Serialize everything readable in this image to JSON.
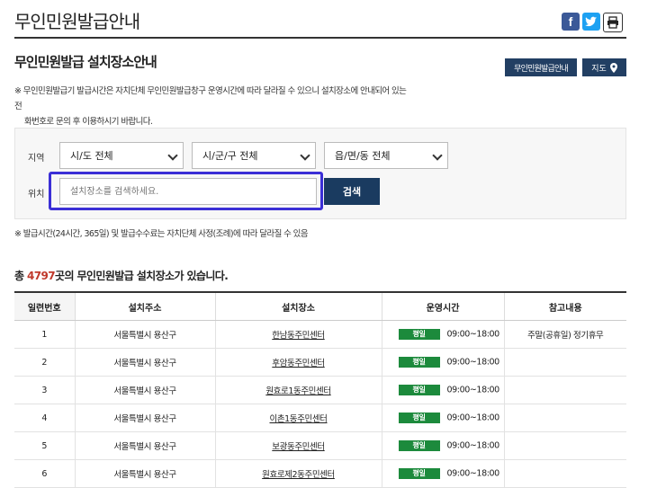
{
  "header": {
    "title": "무인민원발급안내",
    "share": {
      "facebook": "f",
      "twitter": "t",
      "print": "⎙"
    }
  },
  "section": {
    "title": "무인민원발급 설치장소안내",
    "guide_button": "무인민원발급안내",
    "map_button": "지도"
  },
  "notice": {
    "line1": "※ 무인민원발급기 발급시간은 자치단체 무인민원발급창구 운영시간에 따라 달라질 수 있으니 설치장소에 안내되어 있는 전",
    "line2": "화번호로 문의 후 이용하시기 바랍니다."
  },
  "search": {
    "region_label": "지역",
    "location_label": "위치",
    "sido": "시/도 전체",
    "sigungu": "시/군/구 전체",
    "eupmyeondong": "읍/면/동 전체",
    "input_placeholder": "설치장소를 검색하세요.",
    "button": "검색"
  },
  "note2": "※ 발급시간(24시간, 365일) 및 발급수수료는 자치단체 사정(조례)에 따라 달라질 수 있음",
  "count": {
    "prefix": "총 ",
    "number": "4797",
    "suffix": "곳의 무인민원발급 설치장소가 있습니다."
  },
  "table": {
    "headers": [
      "일련번호",
      "설치주소",
      "설치장소",
      "운영시간",
      "참고내용"
    ],
    "rows": [
      {
        "no": "1",
        "address": "서울특별시 용산구",
        "place": "한남동주민센터",
        "badge": "평일",
        "time": "09:00~18:00",
        "note": "주말(공휴일) 정기휴무"
      },
      {
        "no": "2",
        "address": "서울특별시 용산구",
        "place": "후암동주민센터",
        "badge": "평일",
        "time": "09:00~18:00",
        "note": ""
      },
      {
        "no": "3",
        "address": "서울특별시 용산구",
        "place": "원효로1동주민센터",
        "badge": "평일",
        "time": "09:00~18:00",
        "note": ""
      },
      {
        "no": "4",
        "address": "서울특별시 용산구",
        "place": "이촌1동주민센터",
        "badge": "평일",
        "time": "09:00~18:00",
        "note": ""
      },
      {
        "no": "5",
        "address": "서울특별시 용산구",
        "place": "보광동주민센터",
        "badge": "평일",
        "time": "09:00~18:00",
        "note": ""
      },
      {
        "no": "6",
        "address": "서울특별시 용산구",
        "place": "원효로제2동주민센터",
        "badge": "평일",
        "time": "09:00~18:00",
        "note": ""
      }
    ]
  },
  "colors": {
    "primary": "#223f63",
    "badge": "#1c8a3c",
    "count_number": "#c0392b",
    "highlight": "#3b2fd6"
  }
}
